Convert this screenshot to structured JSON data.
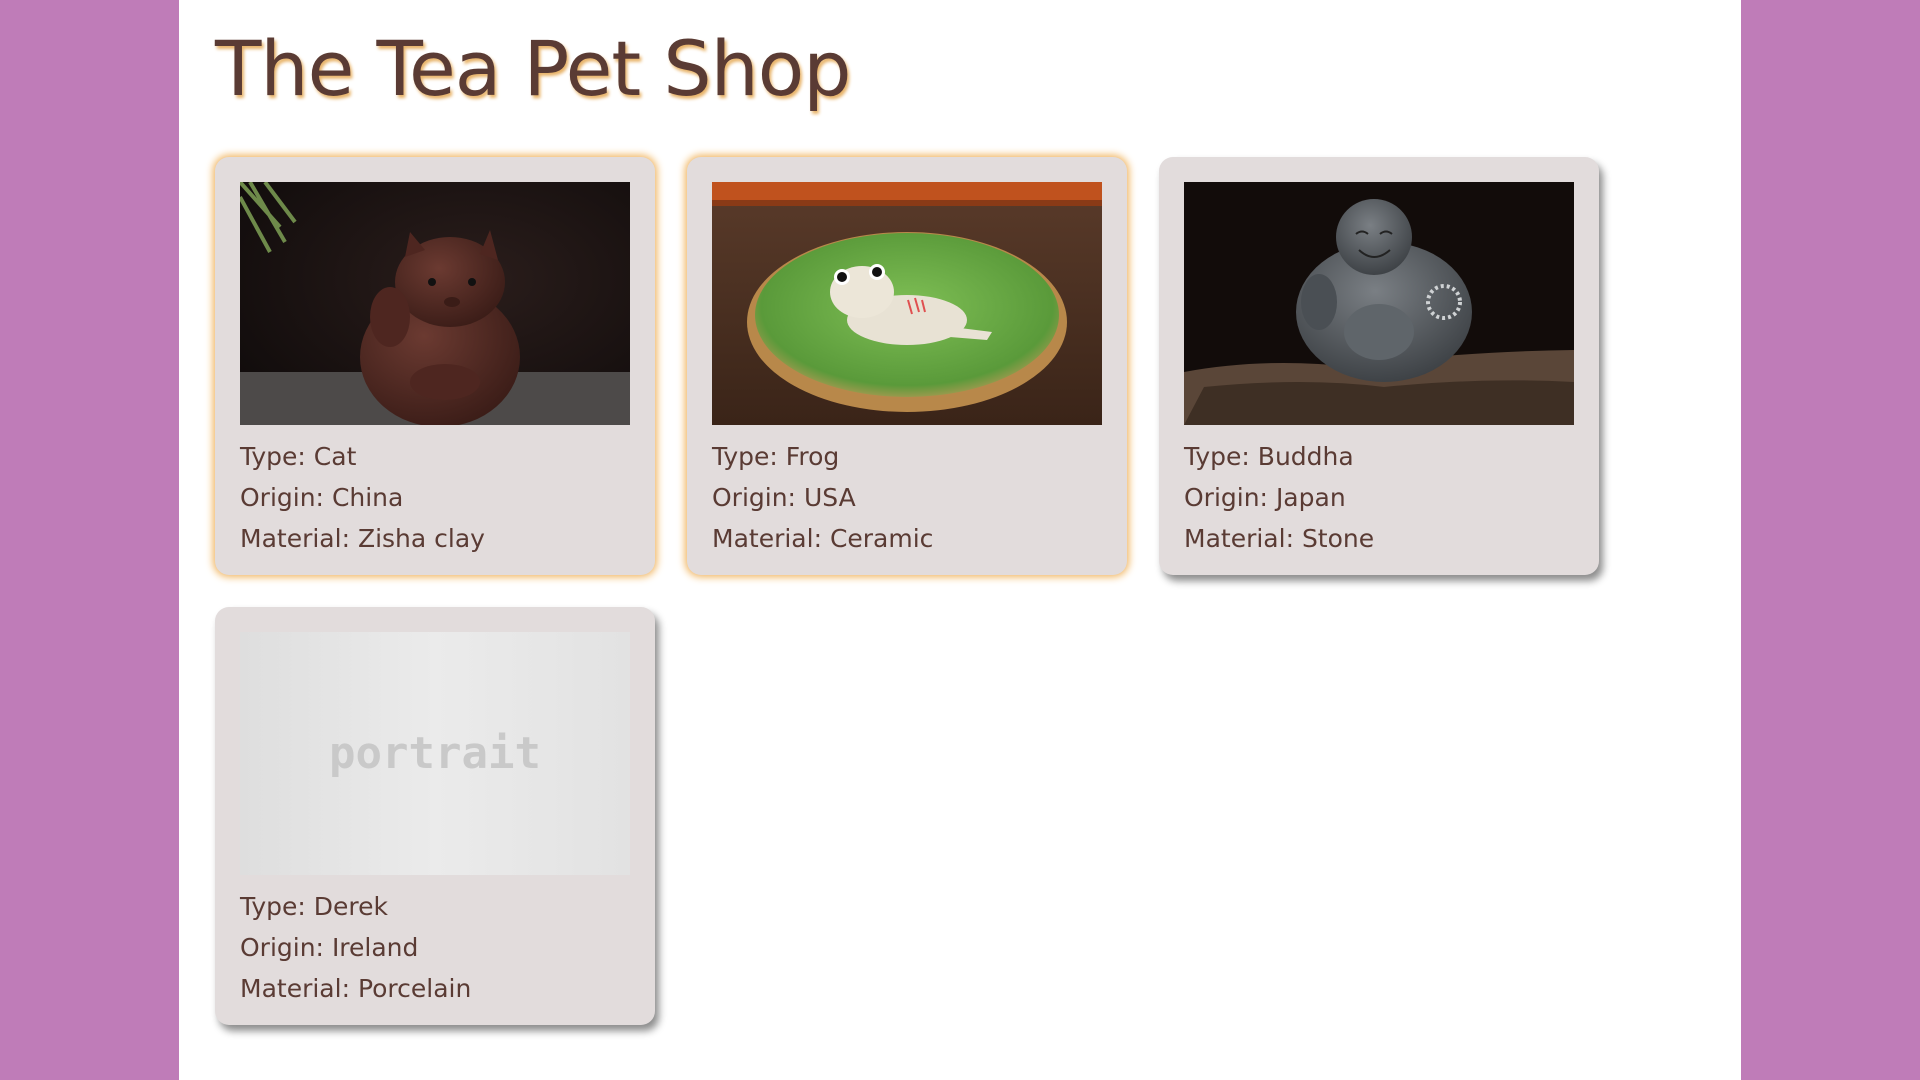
{
  "shop": {
    "title": "The Tea Pet Shop"
  },
  "labels": {
    "type": "Type: ",
    "origin": "Origin: ",
    "material": "Material: "
  },
  "pets": [
    {
      "type": "Cat",
      "origin": "China",
      "material": "Zisha clay",
      "image": "cat-figurine-photo"
    },
    {
      "type": "Frog",
      "origin": "USA",
      "material": "Ceramic",
      "image": "frog-on-leaf-photo"
    },
    {
      "type": "Buddha",
      "origin": "Japan",
      "material": "Stone",
      "image": "buddha-statue-photo"
    },
    {
      "type": "Derek",
      "origin": "Ireland",
      "material": "Porcelain",
      "image": "portrait-placeholder",
      "placeholder_text": "portrait"
    }
  ],
  "colors": {
    "sidebar": "#bf7cb8",
    "title_text": "#5a3b34",
    "title_shadow": "#e8b368",
    "card_background": "#e2dcdc",
    "card_glow": "#f0b45e"
  }
}
